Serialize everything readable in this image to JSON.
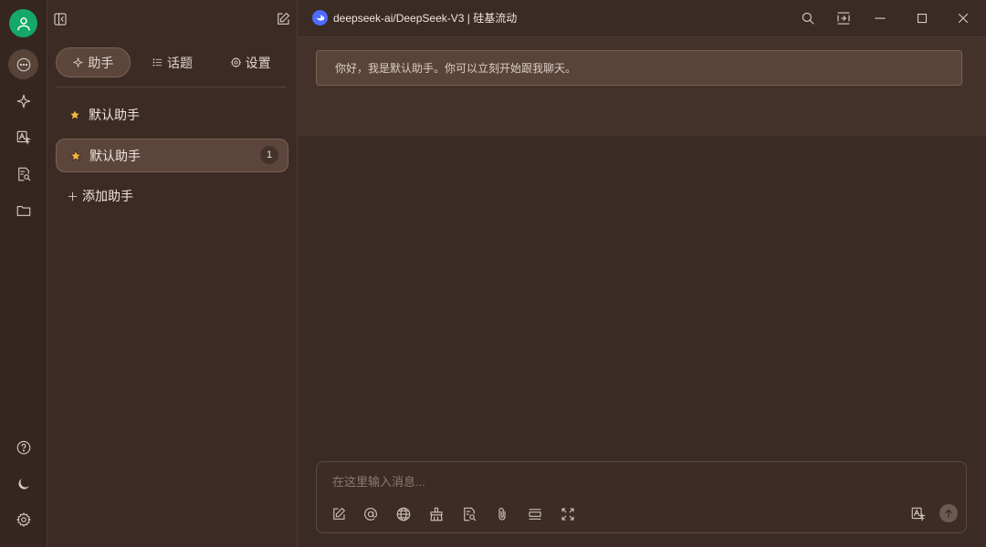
{
  "window": {
    "model_name": "deepseek-ai/DeepSeek-V3 | 硅基流动"
  },
  "panel": {
    "tabs": [
      {
        "label": "助手",
        "icon": "sparkle-icon",
        "active": true
      },
      {
        "label": "话题",
        "icon": "list-icon",
        "active": false
      },
      {
        "label": "设置",
        "icon": "gear-icon",
        "active": false
      }
    ],
    "assistants": [
      {
        "name": "默认助手",
        "icon": "star-icon",
        "active": false
      },
      {
        "name": "默认助手",
        "icon": "star-icon",
        "active": true,
        "count": "1"
      }
    ],
    "add_label": "添加助手"
  },
  "chat": {
    "greeting": "你好，我是默认助手。你可以立刻开始跟我聊天。",
    "input_placeholder": "在这里输入消息..."
  },
  "colors": {
    "background": "#3a2b24",
    "accent_avatar": "#14a86a",
    "star": "#f5b83d",
    "model_logo": "#4d6bfe"
  }
}
